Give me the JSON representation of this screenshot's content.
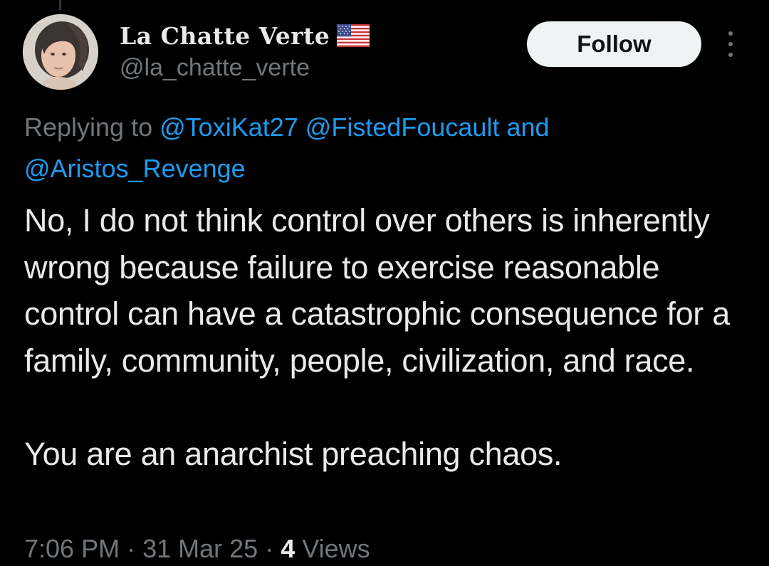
{
  "author": {
    "display_name": "La Chatte Verte",
    "flag_emoji": "🇺🇸",
    "handle": "@la_chatte_verte"
  },
  "follow_button": {
    "label": "Follow"
  },
  "more_menu": {
    "icon": "more-vertical-icon"
  },
  "reply_context": {
    "prefix": "Replying to",
    "mentions": [
      "@ToxiKat27",
      "@FistedFoucault"
    ],
    "conjunction": "and",
    "last_mention": "@Aristos_Revenge"
  },
  "tweet": {
    "paragraphs": [
      "No, I do not think control over others is inherently wrong because failure to exercise reasonable control can have a catastrophic consequence for a family, community, people, civilization, and race.",
      "You are an anarchist preaching chaos."
    ]
  },
  "meta": {
    "time": "7:06 PM",
    "separator": "·",
    "date": "31 Mar 25",
    "views_count": "4",
    "views_label": "Views"
  },
  "colors": {
    "background": "#000000",
    "primary_text": "#e7e9ea",
    "secondary_text": "#71767b",
    "link": "#1d9bf0",
    "follow_bg": "#eff3f4"
  }
}
